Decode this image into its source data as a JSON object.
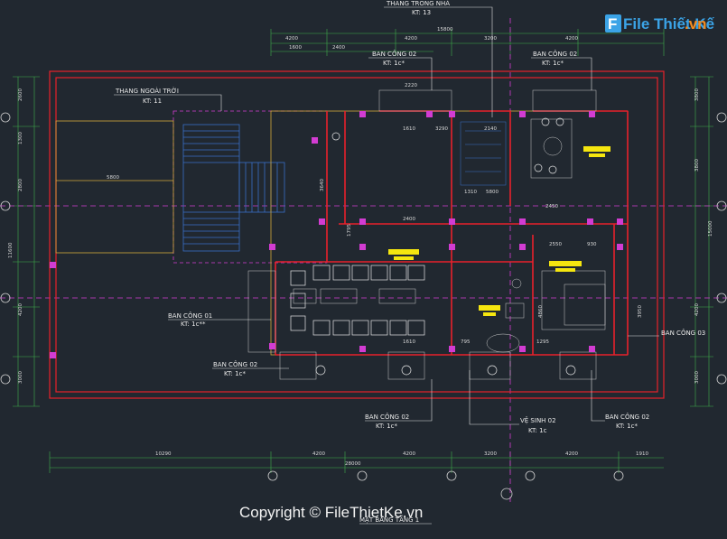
{
  "labels": {
    "stair_inner": "THANG TRONG NHÀ",
    "stair_inner_kt": "KT: 13",
    "stair_outer": "THANG NGOÀI TRỜI",
    "stair_outer_kt": "KT: 11",
    "balcony02_a": "BAN CÔNG 02",
    "balcony02_a_kt": "KT: 1c*",
    "balcony02_b": "BAN CÔNG 02",
    "balcony02_b_kt": "KT: 1c*",
    "balcony01": "BAN CÔNG 01",
    "balcony01_kt": "KT: 1c**",
    "balcony02_c": "BAN CÔNG 02",
    "balcony02_c_kt": "KT: 1c*",
    "balcony03": "BAN CÔNG 03",
    "balcony02_d": "BAN CÔNG 02",
    "balcony02_d_kt": "KT: 1c*",
    "wc02": "VỆ SINH 02",
    "wc02_kt": "KT: 1c",
    "balcony02_e": "BAN CÔNG 02",
    "balcony02_e_kt": "KT: 1c*",
    "plan_title": "MẶT BẰNG TẦNG 1"
  },
  "dims_top1": [
    "4200",
    "4200",
    "3200",
    "4200"
  ],
  "dims_top2": [
    "1600",
    "2400"
  ],
  "dims_top_total": "15800",
  "dims_bottom1": [
    "10290",
    "4200",
    "4200",
    "3200",
    "4200",
    "1910"
  ],
  "dims_bottom_total": "28000",
  "dims_left": [
    "2600",
    "1300",
    "2800",
    "11600",
    "4200",
    "3000"
  ],
  "dims_right": [
    "3800",
    "3800",
    "15000",
    "4200",
    "3000"
  ],
  "inner_dims": [
    "5800",
    "2220",
    "1610",
    "3290",
    "2140",
    "1310",
    "5800",
    "2400",
    "3640",
    "1795",
    "2450",
    "2550",
    "930",
    "1610",
    "1295",
    "795",
    "4860",
    "3950"
  ],
  "watermark": {
    "brand": "File Thiết Kế",
    "domain": ".vn",
    "copyright": "Copyright © FileThietKe.vn"
  },
  "colors": {
    "background": "#212830",
    "wall_red": "#e8212b",
    "axis_magenta": "#d23cd2",
    "dim_green": "#3fae4b",
    "blue": "#3a6ec8",
    "yellow": "#f5e60f",
    "white": "#e0e0e0"
  }
}
